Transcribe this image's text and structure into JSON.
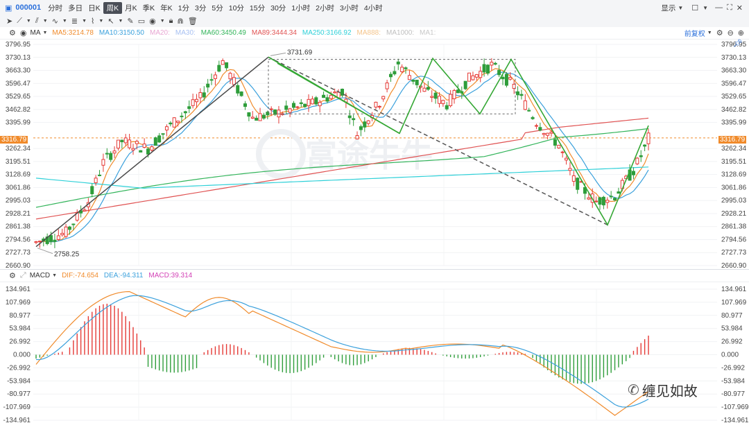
{
  "toolbar": {
    "stock_code": "000001",
    "timeframes": [
      "分时",
      "多日",
      "日K",
      "周K",
      "月K",
      "季K",
      "年K",
      "1分",
      "3分",
      "5分",
      "10分",
      "15分",
      "30分",
      "1小时",
      "2小时",
      "3小时",
      "4小时"
    ],
    "active_timeframe": "周K",
    "display_label": "显示"
  },
  "indicators": {
    "ma_label": "MA",
    "ma_items": [
      {
        "text": "MA5:3214.78",
        "color": "#f08a2a"
      },
      {
        "text": "MA10:3150.50",
        "color": "#3aa0dc"
      },
      {
        "text": "MA20:",
        "color": "#e8a6d3"
      },
      {
        "text": "MA30:",
        "color": "#a7c0f2"
      },
      {
        "text": "MA60:3450.49",
        "color": "#32b45a"
      },
      {
        "text": "MA89:3444.34",
        "color": "#e05252"
      },
      {
        "text": "MA250:3166.92",
        "color": "#2ed0d8"
      },
      {
        "text": "MA888:",
        "color": "#f4c48a"
      },
      {
        "text": "MA1000:",
        "color": "#bfbfbf"
      },
      {
        "text": "MA1:",
        "color": "#c9c9c9"
      }
    ],
    "adjust_label": "前复权",
    "macd_label": "MACD",
    "macd_items": [
      {
        "text": "DIF:-74.654",
        "color": "#f08a2a"
      },
      {
        "text": "DEA:-94.311",
        "color": "#3aa0dc"
      },
      {
        "text": "MACD:39.314",
        "color": "#d23fb5"
      }
    ]
  },
  "price_axis": [
    "3796.95",
    "3730.13",
    "3663.30",
    "3596.47",
    "3529.65",
    "3462.82",
    "3395.99",
    "3316.79",
    "3262.34",
    "3195.51",
    "3128.69",
    "3061.86",
    "2995.03",
    "2928.21",
    "2861.38",
    "2794.56",
    "2727.73",
    "2660.90"
  ],
  "macd_axis": [
    "134.961",
    "107.969",
    "80.977",
    "53.984",
    "26.992",
    "0.000",
    "-26.992",
    "-53.984",
    "-80.977",
    "-107.969",
    "-134.961"
  ],
  "annotations": {
    "high": "3731.69",
    "low": "2758.25",
    "current": "3316.79"
  },
  "watermark": {
    "text": "富途牛牛",
    "wechat": "缠见如故"
  },
  "colors": {
    "up": "#e53935",
    "down": "#2e9d3a",
    "pattern": "#34a734",
    "trend": "#4a4a4a"
  }
}
